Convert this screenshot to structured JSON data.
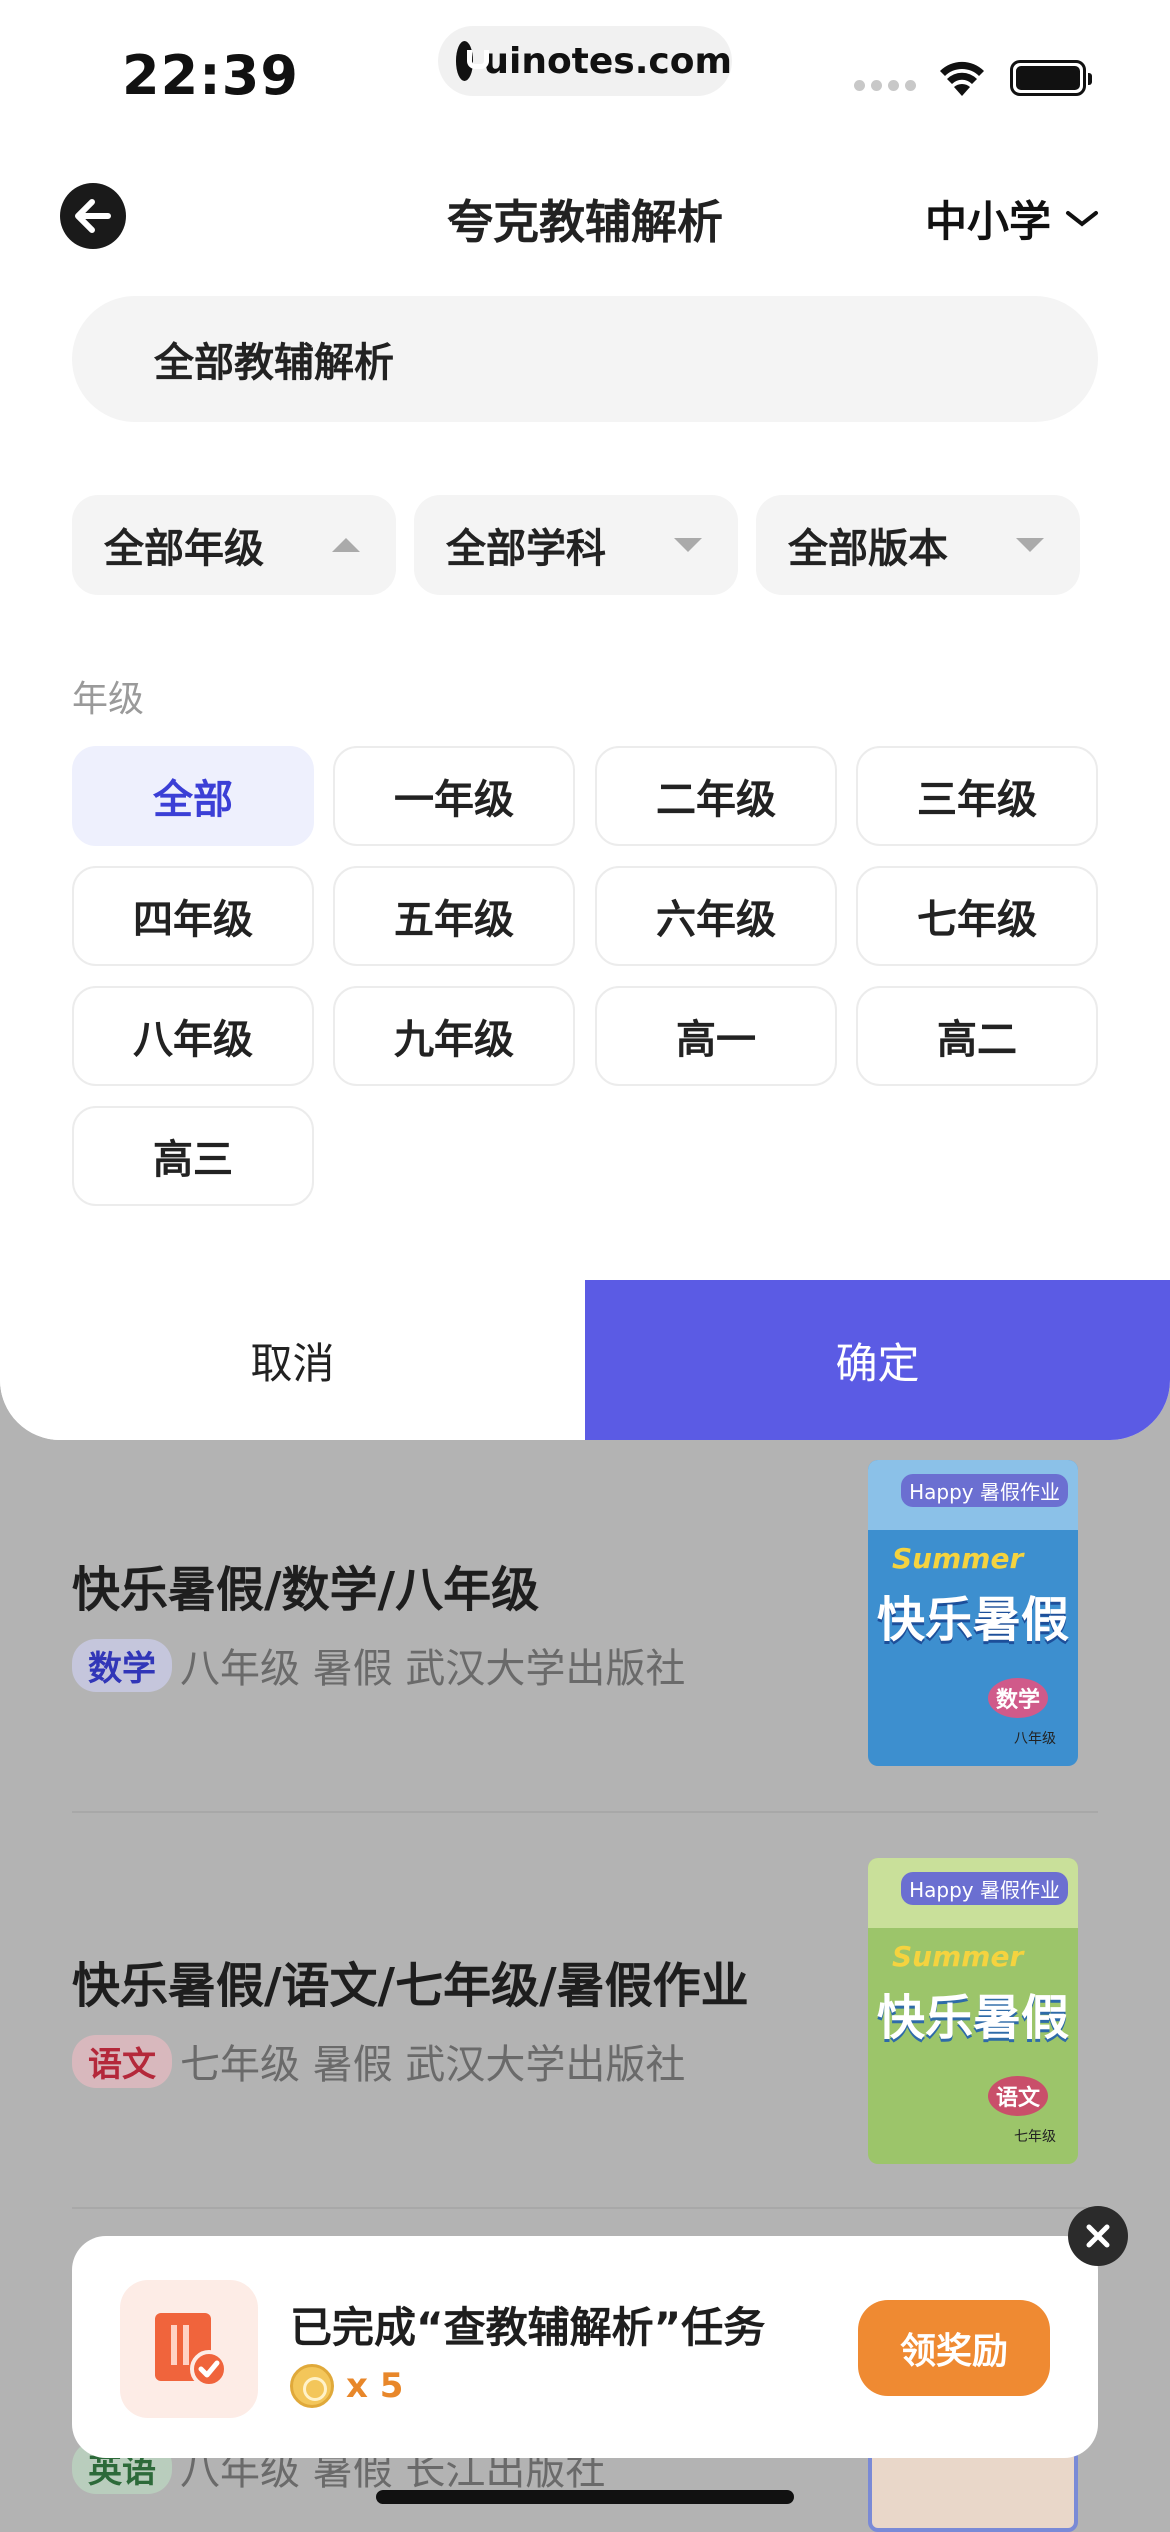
{
  "status_bar": {
    "time": "22:39",
    "url": "uinotes.com"
  },
  "header": {
    "title": "夸克教辅解析",
    "level": "中小学"
  },
  "search": {
    "value": "全部教辅解析"
  },
  "filters": [
    {
      "label": "全部年级",
      "expanded": true
    },
    {
      "label": "全部学科",
      "expanded": false
    },
    {
      "label": "全部版本",
      "expanded": false
    }
  ],
  "grade_section": {
    "label": "年级",
    "options": [
      "全部",
      "一年级",
      "二年级",
      "三年级",
      "四年级",
      "五年级",
      "六年级",
      "七年级",
      "八年级",
      "九年级",
      "高一",
      "高二",
      "高三"
    ],
    "selected": "全部"
  },
  "actions": {
    "cancel": "取消",
    "confirm": "确定"
  },
  "results": [
    {
      "title": "快乐暑假/数学/八年级",
      "subject": "数学",
      "meta": "八年级 暑假 武汉大学出版社",
      "cover": {
        "happy": "Happy 暑假作业",
        "summer": "Summer",
        "title": "快乐暑假",
        "subject": "数学",
        "grade": "八年级"
      }
    },
    {
      "title": "快乐暑假/语文/七年级/暑假作业",
      "subject": "语文",
      "meta": "七年级 暑假 武汉大学出版社",
      "cover": {
        "happy": "Happy 暑假作业",
        "summer": "Summer",
        "title": "快乐暑假",
        "subject": "语文",
        "grade": "七年级"
      }
    },
    {
      "title": "",
      "subject": "英语",
      "meta": "八年级 暑假 长江出版社"
    }
  ],
  "toast": {
    "title": "已完成“查教辅解析”任务",
    "reward": "x 5",
    "button": "领奖励"
  },
  "colors": {
    "accent": "#5b5be4",
    "selected_chip_bg": "#eef0fd",
    "selected_chip_text": "#3b3fd6",
    "reward_orange": "#ef8a32"
  }
}
